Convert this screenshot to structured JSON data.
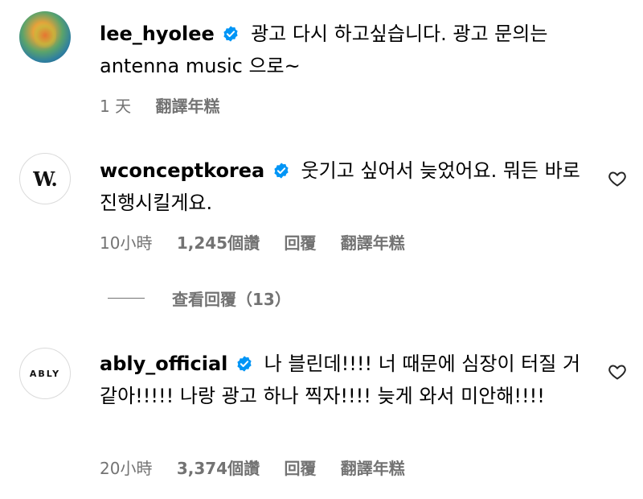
{
  "comments": [
    {
      "username": "lee_hyolee",
      "text": "광고 다시 하고싶습니다. 광고 문의는 antenna music 으로~",
      "time": "1 天",
      "translate": "翻譯年糕"
    },
    {
      "username": "wconceptkorea",
      "text": "웃기고 싶어서 늦었어요. 뭐든 바로 진행시킬게요.",
      "time": "10小時",
      "likes": "1,245個讚",
      "reply": "回覆",
      "translate": "翻譯年糕",
      "view_replies": "查看回覆（13）",
      "avatar_text": "W."
    },
    {
      "username": "ably_official",
      "text": "나 블린데!!!! 너 때문에 심장이 터질 거 같아!!!!! 나랑 광고 하나 찍자!!!! 늦게 와서 미안해!!!!",
      "time": "20小時",
      "likes": "3,374個讚",
      "reply": "回覆",
      "translate": "翻譯年糕",
      "avatar_text": "ABLY"
    }
  ],
  "colors": {
    "verified": "#0095f6",
    "secondary_text": "#737373"
  },
  "icons": {
    "verified": "verified-badge-icon",
    "like": "heart-outline-icon"
  }
}
